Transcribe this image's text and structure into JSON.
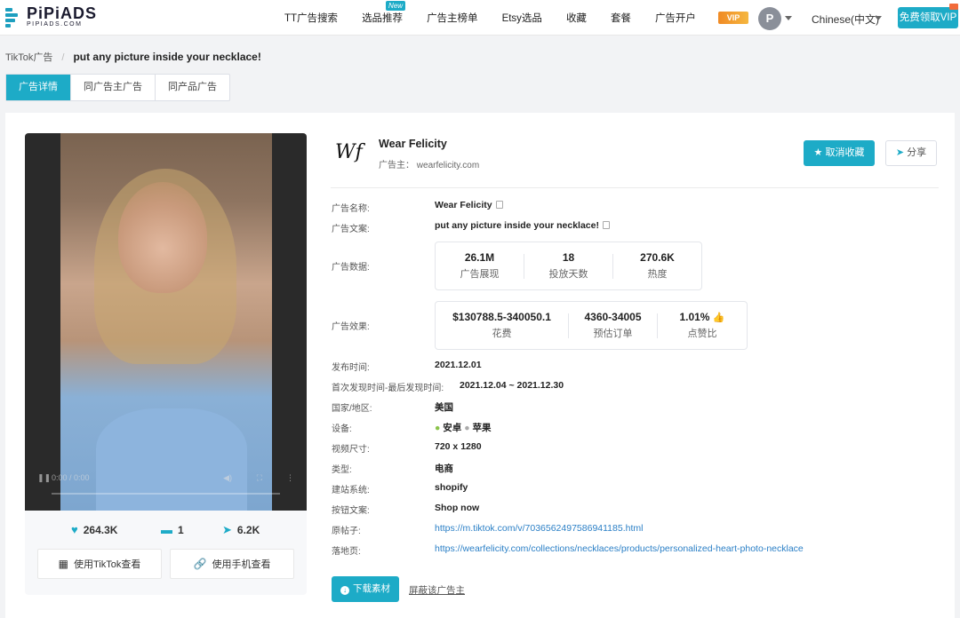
{
  "brand": {
    "name": "PiPiADS",
    "domain": "PIPIADS.COM",
    "accent": "#1dabc7"
  },
  "nav": {
    "items": [
      {
        "label": "TT广告搜索"
      },
      {
        "label": "选品推荐",
        "badge": "New"
      },
      {
        "label": "广告主榜单"
      },
      {
        "label": "Etsy选品"
      },
      {
        "label": "收藏"
      },
      {
        "label": "套餐"
      },
      {
        "label": "广告开户"
      }
    ],
    "vip_logo": "VIP",
    "avatar_letter": "P",
    "language": "Chinese(中文)",
    "vip_button": "免费领取VIP"
  },
  "breadcrumb": {
    "root": "TikTok广告",
    "separator": "/",
    "current": "put any picture inside your necklace!"
  },
  "tabs": [
    {
      "label": "广告详情",
      "active": true
    },
    {
      "label": "同广告主广告",
      "active": false
    },
    {
      "label": "同产品广告",
      "active": false
    }
  ],
  "video": {
    "time": "0:00 / 0:00",
    "likes": "264.3K",
    "comments": "1",
    "shares": "6.2K",
    "btn_tiktok": "使用TikTok查看",
    "btn_mobile": "使用手机查看"
  },
  "advertiser": {
    "logo_text": "Wf",
    "name": "Wear Felicity",
    "site_label": "广告主：",
    "site": "wearfelicity.com",
    "fav_button": "取消收藏",
    "share_button": "分享"
  },
  "details": {
    "ad_name_label": "广告名称:",
    "ad_name": "Wear Felicity",
    "ad_copy_label": "广告文案:",
    "ad_copy": "put any picture inside your necklace!",
    "ad_data_label": "广告数据:",
    "ad_data": [
      {
        "value": "26.1M",
        "caption": "广告展现"
      },
      {
        "value": "18",
        "caption": "投放天数"
      },
      {
        "value": "270.6K",
        "caption": "热度"
      }
    ],
    "ad_effect_label": "广告效果:",
    "ad_effect": [
      {
        "value": "$130788.5-340050.1",
        "caption": "花费"
      },
      {
        "value": "4360-34005",
        "caption": "预估订单"
      },
      {
        "value": "1.01%",
        "caption": "点赞比"
      }
    ],
    "publish_label": "发布时间:",
    "publish": "2021.12.01",
    "first_last_label": "首次发现时间-最后发现时间:",
    "first_last": "2021.12.04 ~ 2021.12.30",
    "country_label": "国家/地区:",
    "country": "美国",
    "device_label": "设备:",
    "device_android": "安卓",
    "device_apple": "苹果",
    "size_label": "视频尺寸:",
    "size": "720 x 1280",
    "type_label": "类型:",
    "type": "电商",
    "site_system_label": "建站系统:",
    "site_system": "shopify",
    "button_copy_label": "按钮文案:",
    "button_copy": "Shop now",
    "post_label": "原帖子:",
    "post_url": "https://m.tiktok.com/v/7036562497586941185.html",
    "landing_label": "落地页:",
    "landing_url": "https://wearfelicity.com/collections/necklaces/products/personalized-heart-photo-necklace"
  },
  "actions": {
    "download": "下载素材",
    "block": "屏蔽该广告主"
  }
}
